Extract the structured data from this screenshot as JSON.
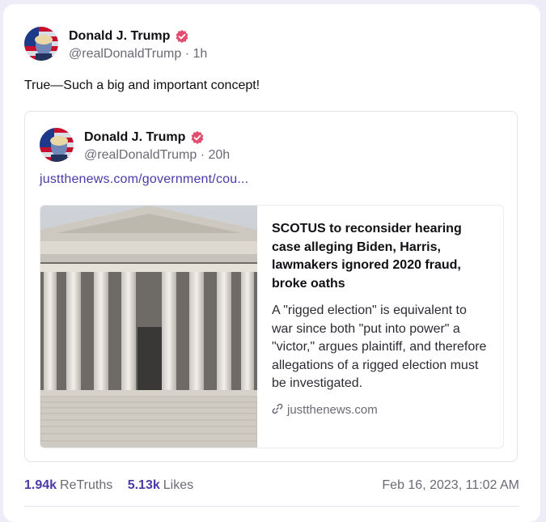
{
  "post": {
    "author_name": "Donald J. Trump",
    "author_handle": "@realDonaldTrump",
    "age": "1h",
    "text": "True—Such a big and important concept!"
  },
  "quoted": {
    "author_name": "Donald J. Trump",
    "author_handle": "@realDonaldTrump",
    "age": "20h",
    "link_text": "justthenews.com/government/cou...",
    "card": {
      "title": "SCOTUS to reconsider hearing case alleging Biden, Harris, lawmakers ignored 2020 fraud, broke oaths",
      "description": "A \"rigged election\" is equivalent to war since both \"put into power\" a \"victor,\" argues plaintiff, and therefore allegations of a rigged election must be investigated.",
      "domain": "justthenews.com"
    }
  },
  "stats": {
    "retruths_count": "1.94k",
    "retruths_label": "ReTruths",
    "likes_count": "5.13k",
    "likes_label": "Likes",
    "timestamp": "Feb 16, 2023, 11:02 AM"
  },
  "colors": {
    "accent": "#4a3aa8",
    "verified": "#e04d6e",
    "muted": "#6a6a75"
  },
  "icons": [
    "verified-badge-icon",
    "link-icon"
  ]
}
